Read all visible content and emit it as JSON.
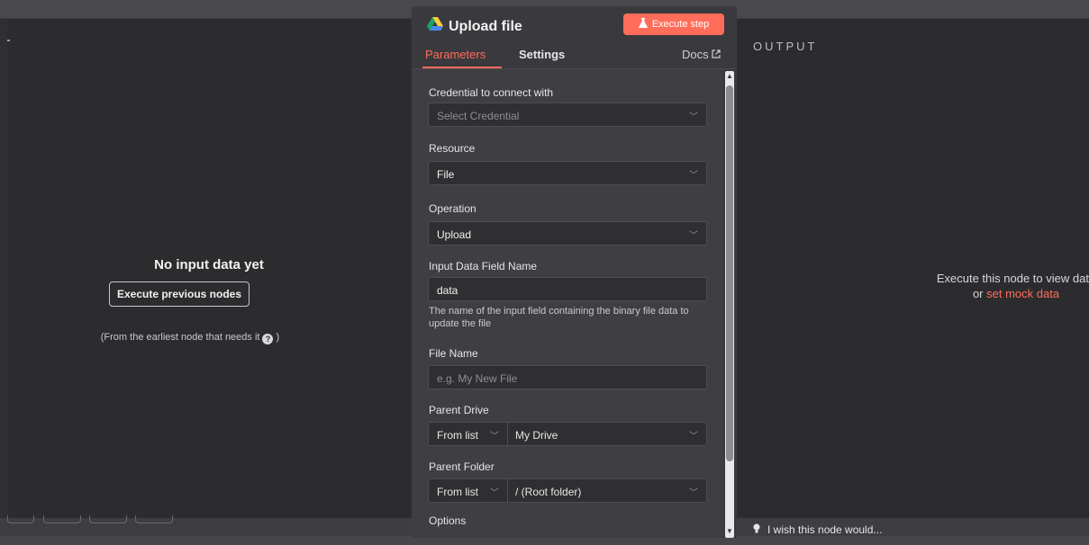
{
  "left_panel": {
    "title": "No input data yet",
    "execute_previous_label": "Execute previous nodes",
    "hint_text": "(From the earliest node that needs it",
    "hint_close": ")"
  },
  "node": {
    "title": "Upload file",
    "execute_step_label": "Execute step",
    "tabs": {
      "parameters": "Parameters",
      "settings": "Settings",
      "docs": "Docs"
    },
    "fields": {
      "credential": {
        "label": "Credential to connect with",
        "placeholder": "Select Credential"
      },
      "resource": {
        "label": "Resource",
        "value": "File"
      },
      "operation": {
        "label": "Operation",
        "value": "Upload"
      },
      "input_field": {
        "label": "Input Data Field Name",
        "value": "data",
        "helper": "The name of the input field containing the binary file data to update the file"
      },
      "file_name": {
        "label": "File Name",
        "placeholder": "e.g. My New File"
      },
      "parent_drive": {
        "label": "Parent Drive",
        "mode": "From list",
        "value": "My Drive"
      },
      "parent_folder": {
        "label": "Parent Folder",
        "mode": "From list",
        "value": "/ (Root folder)"
      },
      "options": {
        "label": "Options"
      }
    }
  },
  "output_panel": {
    "label": "OUTPUT",
    "message": "Execute this node to view data",
    "or_text": "or",
    "mock_link": "set mock data"
  },
  "feedback": {
    "text": "I wish this node would..."
  },
  "colors": {
    "accent": "#ff6d5a",
    "panel_bg": "#2c2c2f",
    "node_bg": "#3a3a3e",
    "field_bg": "#2f2f32"
  }
}
